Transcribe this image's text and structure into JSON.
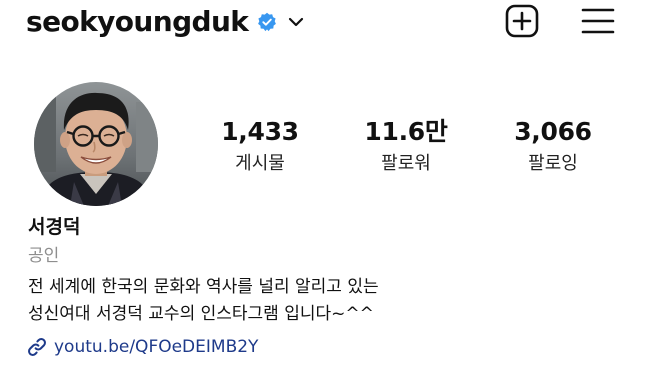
{
  "header": {
    "username": "seokyoungduk",
    "icons": {
      "verified": "verified-badge-icon",
      "chevron": "chevron-down-icon",
      "new_post": "plus-square-icon",
      "menu": "hamburger-menu-icon"
    },
    "colors": {
      "verified": "#3897f0"
    }
  },
  "profile": {
    "avatar": "profile-photo",
    "stats": [
      {
        "value": "1,433",
        "label": "게시물"
      },
      {
        "value": "11.6만",
        "label": "팔로워"
      },
      {
        "value": "3,066",
        "label": "팔로잉"
      }
    ],
    "name": "서경덕",
    "category": "공인",
    "bio_lines": [
      "전 세계에 한국의 문화와 역사를 널리 알리고 있는",
      "성신여대 서경덕 교수의 인스타그램 입니다~^^"
    ],
    "link": {
      "icon": "link-icon",
      "text": "youtu.be/QFOeDEIMB2Y",
      "color": "#1e3a8a"
    }
  }
}
